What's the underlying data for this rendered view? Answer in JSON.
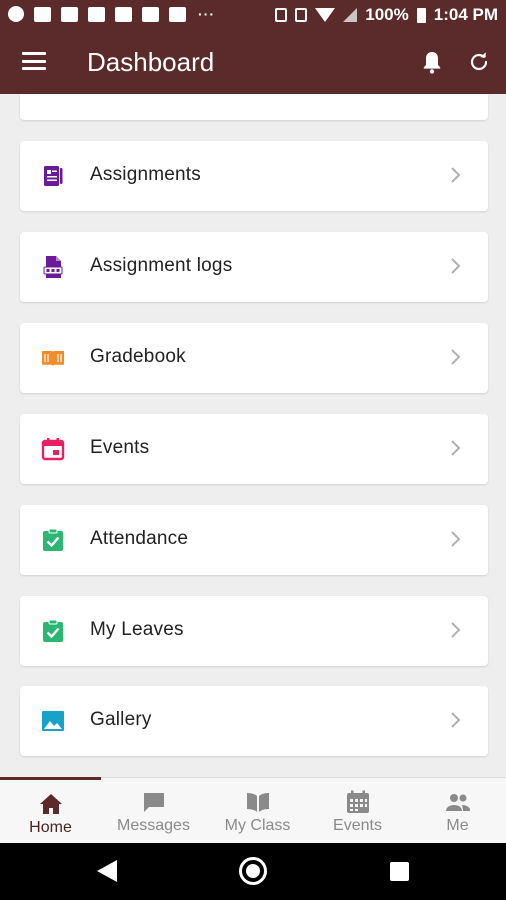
{
  "status_bar": {
    "battery": "100%",
    "time": "1:04 PM",
    "more": "···"
  },
  "app_bar": {
    "title": "Dashboard"
  },
  "menu": [
    {
      "label": "Assignments",
      "icon": "assignment-icon",
      "color": "#6a1b9a"
    },
    {
      "label": "Assignment logs",
      "icon": "log-file-icon",
      "color": "#6a1b9a"
    },
    {
      "label": "Gradebook",
      "icon": "book-icon",
      "color": "#f28c28"
    },
    {
      "label": "Events",
      "icon": "calendar-icon",
      "color": "#e91e63"
    },
    {
      "label": "Attendance",
      "icon": "clipboard-check-icon",
      "color": "#2bb673"
    },
    {
      "label": "My Leaves",
      "icon": "clipboard-check-icon",
      "color": "#2bb673"
    },
    {
      "label": "Gallery",
      "icon": "image-icon",
      "color": "#17a2c8"
    }
  ],
  "bottom_nav": [
    {
      "label": "Home",
      "icon": "home-icon",
      "active": true
    },
    {
      "label": "Messages",
      "icon": "chat-icon",
      "active": false
    },
    {
      "label": "My Class",
      "icon": "open-book-icon",
      "active": false
    },
    {
      "label": "Events",
      "icon": "calendar-grid-icon",
      "active": false
    },
    {
      "label": "Me",
      "icon": "people-icon",
      "active": false
    }
  ],
  "colors": {
    "app_bar": "#5b2a2a",
    "background": "#eeeeee"
  }
}
